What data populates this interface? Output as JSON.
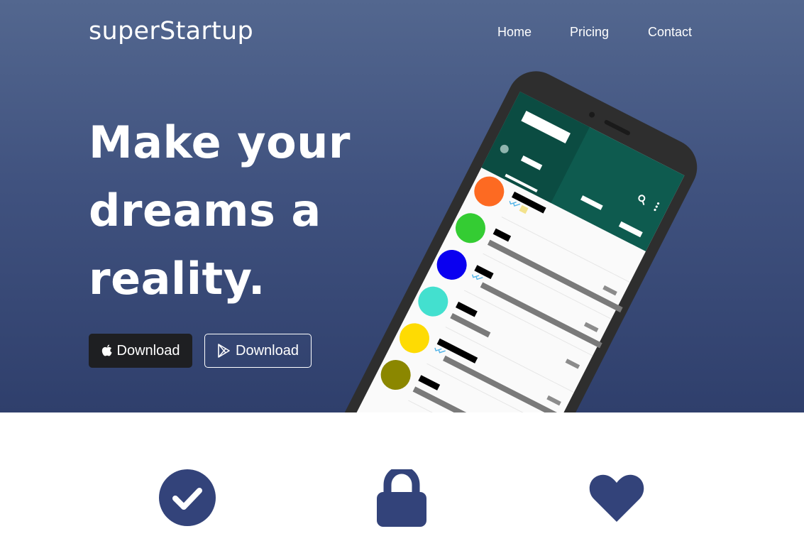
{
  "brand": {
    "name": "superStartup"
  },
  "nav": {
    "items": [
      "Home",
      "Pricing",
      "Contact"
    ]
  },
  "hero": {
    "headline_lines": [
      "Make your",
      "dreams a",
      "reality."
    ],
    "buttons": {
      "apple": {
        "label": "Download",
        "icon": "apple-icon"
      },
      "play": {
        "label": "Download",
        "icon": "google-play-icon"
      }
    }
  },
  "features": {
    "icons": [
      "check-circle-icon",
      "lock-icon",
      "heart-icon"
    ]
  },
  "colors": {
    "hero_top": "#53678f",
    "hero_bottom": "#2f3f6c",
    "icon_navy": "#33437a",
    "apple_button_bg": "#1e1f22",
    "app_header": "#0e5b4f"
  },
  "phone_mock": {
    "avatar_colors": [
      "#fd6a22",
      "#34cc33",
      "#0a00f0",
      "#43e0cf",
      "#fedb03",
      "#8b8700"
    ]
  }
}
